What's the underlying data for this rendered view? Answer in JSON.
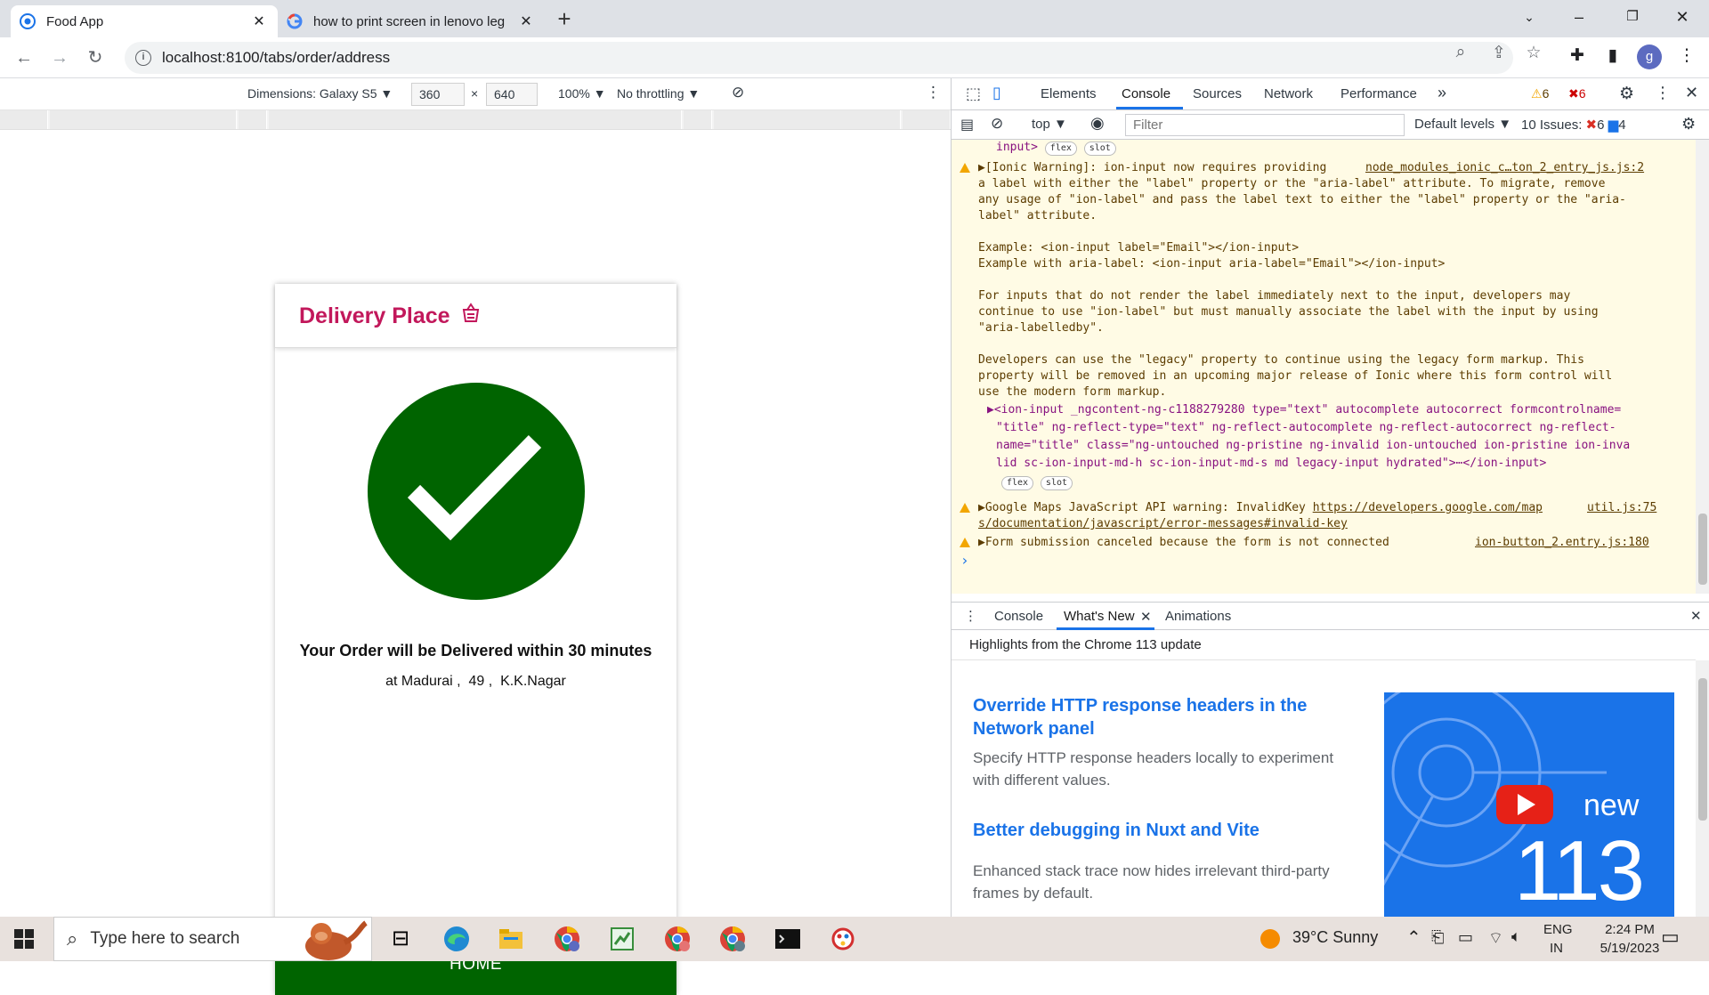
{
  "browser": {
    "tabs": [
      {
        "title": "Food App",
        "active": true
      },
      {
        "title": "how to print screen in lenovo leg",
        "active": false
      }
    ],
    "new_tab": "+",
    "url": "localhost:8100/tabs/order/address",
    "profile_initial": "g"
  },
  "device_toolbar": {
    "dimensions_label": "Dimensions: Galaxy S5 ▼",
    "width": "360",
    "times": "×",
    "height": "640",
    "zoom": "100% ▼",
    "throttling": "No throttling ▼"
  },
  "app": {
    "title": "Delivery Place",
    "order_message": "Your Order will be Delivered within 30 minutes",
    "address": "at Madurai ,  49 ,  K.K.Nagar",
    "home_button": "HOME",
    "accent_color": "#006400",
    "title_color": "#c2185b"
  },
  "devtools": {
    "tabs": [
      "Elements",
      "Console",
      "Sources",
      "Network",
      "Performance"
    ],
    "more_tabs": "»",
    "warn_count": "6",
    "error_count": "6",
    "context": "top ▼",
    "filter_placeholder": "Filter",
    "levels": "Default levels ▼",
    "issues_label": "10 Issues:",
    "issues_err": "6",
    "issues_info": "4",
    "log": {
      "top_frag": "input>",
      "pill_flex": "flex",
      "pill_slot": "slot",
      "w1_link": "node_modules_ionic_c…ton_2_entry_js.js:2",
      "w1_lines": [
        "▶[Ionic Warning]: ion-input now requires providing",
        "a label with either the \"label\" property or the \"aria-label\" attribute. To migrate, remove",
        "any usage of \"ion-label\" and pass the label text to either the \"label\" property or the \"aria-",
        "label\" attribute.",
        "",
        "Example: <ion-input label=\"Email\"></ion-input>",
        "Example with aria-label: <ion-input aria-label=\"Email\"></ion-input>",
        "",
        "For inputs that do not render the label immediately next to the input, developers may",
        "continue to use \"ion-label\" but must manually associate the label with the input by using",
        "\"aria-labelledby\".",
        "",
        "Developers can use the \"legacy\" property to continue using the legacy form markup. This",
        "property will be removed in an upcoming major release of Ionic where this form control will",
        "use the modern form markup."
      ],
      "el_lines": [
        "▶<ion-input _ngcontent-ng-c1188279280 type=\"text\" autocomplete autocorrect formcontrolname=",
        "\"title\" ng-reflect-type=\"text\" ng-reflect-autocomplete ng-reflect-autocorrect ng-reflect-",
        "name=\"title\" class=\"ng-untouched ng-pristine ng-invalid ion-untouched ion-pristine ion-inva",
        "lid sc-ion-input-md-h sc-ion-input-md-s md legacy-input hydrated\">⋯</ion-input>"
      ],
      "w2_text": "▶Google Maps JavaScript API warning: InvalidKey",
      "w2_url1": "https://developers.google.com/map",
      "w2_src": "util.js:75",
      "w2_url2": "s/documentation/javascript/error-messages#invalid-key",
      "w3_text": "▶Form submission canceled because the form is not connected",
      "w3_src": "ion-button_2.entry.js:180",
      "prompt": "›"
    },
    "drawer_tabs": [
      "Console",
      "What's New",
      "Animations"
    ],
    "whats_new": {
      "highlight": "Highlights from the Chrome 113 update",
      "items": [
        {
          "title": "Override HTTP response headers in the Network panel",
          "desc": "Specify HTTP response headers locally to experiment with different values."
        },
        {
          "title": "Better debugging in Nuxt and Vite",
          "desc": "Enhanced stack trace now hides irrelevant third-party frames by default."
        }
      ],
      "img_new": "new",
      "img_version": "113"
    }
  },
  "taskbar": {
    "search_placeholder": "Type here to search",
    "weather": "39°C  Sunny",
    "lang1": "ENG",
    "lang2": "IN",
    "time": "2:24 PM",
    "date": "5/19/2023"
  }
}
